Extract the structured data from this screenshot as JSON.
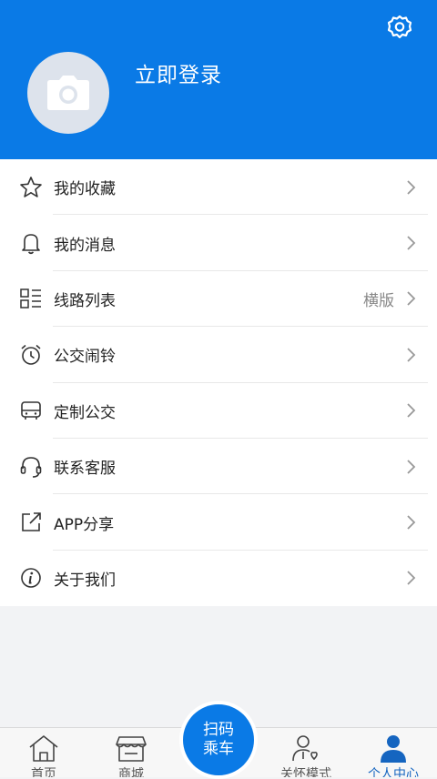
{
  "header": {
    "login_label": "立即登录"
  },
  "menu": {
    "items": [
      {
        "label": "我的收藏",
        "extra": "",
        "icon": "star-icon"
      },
      {
        "label": "我的消息",
        "extra": "",
        "icon": "bell-icon"
      },
      {
        "label": "线路列表",
        "extra": "横版",
        "icon": "list-icon"
      },
      {
        "label": "公交闹铃",
        "extra": "",
        "icon": "alarm-clock-icon"
      },
      {
        "label": "定制公交",
        "extra": "",
        "icon": "bus-icon"
      },
      {
        "label": "联系客服",
        "extra": "",
        "icon": "headset-icon"
      },
      {
        "label": "APP分享",
        "extra": "",
        "icon": "share-icon"
      },
      {
        "label": "关于我们",
        "extra": "",
        "icon": "info-icon"
      }
    ]
  },
  "tabbar": {
    "tabs": [
      {
        "label": "首页",
        "icon": "home-icon"
      },
      {
        "label": "商城",
        "icon": "store-icon"
      },
      {
        "label": "关怀模式",
        "icon": "care-mode-icon"
      },
      {
        "label": "个人中心",
        "icon": "person-icon",
        "active": true
      }
    ],
    "scan": {
      "line1": "扫码",
      "line2": "乘车"
    }
  },
  "colors": {
    "primary": "#0a7ae6",
    "active_tab": "#1565c0",
    "background": "#f2f3f5"
  }
}
